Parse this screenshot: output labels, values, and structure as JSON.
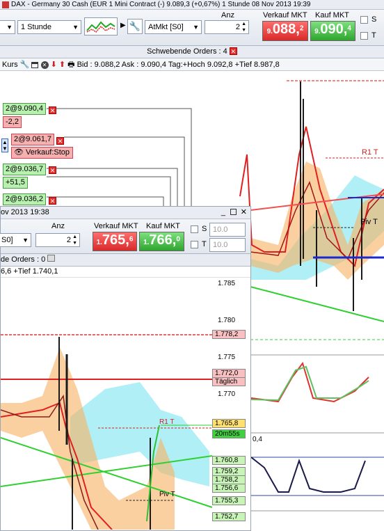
{
  "title_bar": {
    "text": "DAX - Germany 30 Cash (EUR 1 Mini Contract (-)   9.089,3 (+0,67%)   1 Stunde  08 Nov 2013 19:39"
  },
  "toolbar": {
    "timeframe": "1 Stunde",
    "order_type": "AtMkt [S0]",
    "anz_label": "Anz",
    "anz_value": "2",
    "sell_label": "Verkauf MKT",
    "buy_label": "Kauf MKT",
    "sell_price_main": "088,",
    "sell_price_prefix": "9.",
    "sell_price_suffix": "2",
    "buy_price_prefix": "9.",
    "buy_price_main": "090,",
    "buy_price_suffix": "4",
    "s_label": "S",
    "t_label": "T"
  },
  "pending_orders": {
    "label": "Schwebende Orders :",
    "count": "4"
  },
  "info_bar": {
    "kurs": "Kurs",
    "text": "Bid : 9.088,2 Ask : 9.090,4 Tag:+Hoch 9.092,8 +Tief 8.987,8"
  },
  "order_tags": [
    {
      "text": "2@9.090,4",
      "kind": "green"
    },
    {
      "text": "-2,2",
      "kind": "red"
    },
    {
      "text": "2@9.061,7",
      "kind": "red"
    },
    {
      "text": "Verkauf:Stop",
      "kind": "red"
    },
    {
      "text": "2@9.036,7",
      "kind": "green"
    },
    {
      "text": "+51,5",
      "kind": "green"
    },
    {
      "text": "2@9.036,2",
      "kind": "green"
    }
  ],
  "main_chart_labels": {
    "r1": "R1 T",
    "piv": "Piv T",
    "osc_value": "0,4"
  },
  "window2": {
    "title": "ov 2013 19:38",
    "anz_label": "Anz",
    "anz_value": "2",
    "order_type": "S0]",
    "sell_label": "Verkauf MKT",
    "buy_label": "Kauf MKT",
    "sell_prefix": "1.",
    "sell_main": "765,",
    "sell_suffix": "6",
    "buy_prefix": "1.",
    "buy_main": "766,",
    "buy_suffix": "0",
    "s_label": "S",
    "t_label": "T",
    "s_value": "10.0",
    "t_value": "10.0",
    "orders_label": "de Orders :",
    "orders_count": "0",
    "info_text": "6,6 +Tief 1.740,1",
    "axis_labels": [
      "1.785",
      "1.780",
      "1.775",
      "1.770"
    ],
    "price_tags": [
      {
        "text": "1.778,2",
        "kind": "pink"
      },
      {
        "text": "1.772,0",
        "kind": "pink"
      },
      {
        "text": "Täglich",
        "kind": "pink"
      },
      {
        "text": "1.765,8",
        "kind": "yellow"
      },
      {
        "text": "20m55s",
        "kind": "green"
      },
      {
        "text": "1.760,8",
        "kind": "lgreen"
      },
      {
        "text": "1.759,2",
        "kind": "lgreen"
      },
      {
        "text": "1.758,2",
        "kind": "lgreen"
      },
      {
        "text": "1.756,6",
        "kind": "lgreen"
      },
      {
        "text": "1.755,3",
        "kind": "lgreen"
      },
      {
        "text": "1.752,7",
        "kind": "lgreen"
      }
    ],
    "r1": "R1 T",
    "piv": "Piv T"
  },
  "colors": {
    "sell": "#d92a2a",
    "buy": "#2fa52f",
    "ma_red": "#e02020",
    "band_orange": "#f7b060",
    "cloud_cyan": "#7fe6f0",
    "candle_dark": "#1a1a1a"
  }
}
